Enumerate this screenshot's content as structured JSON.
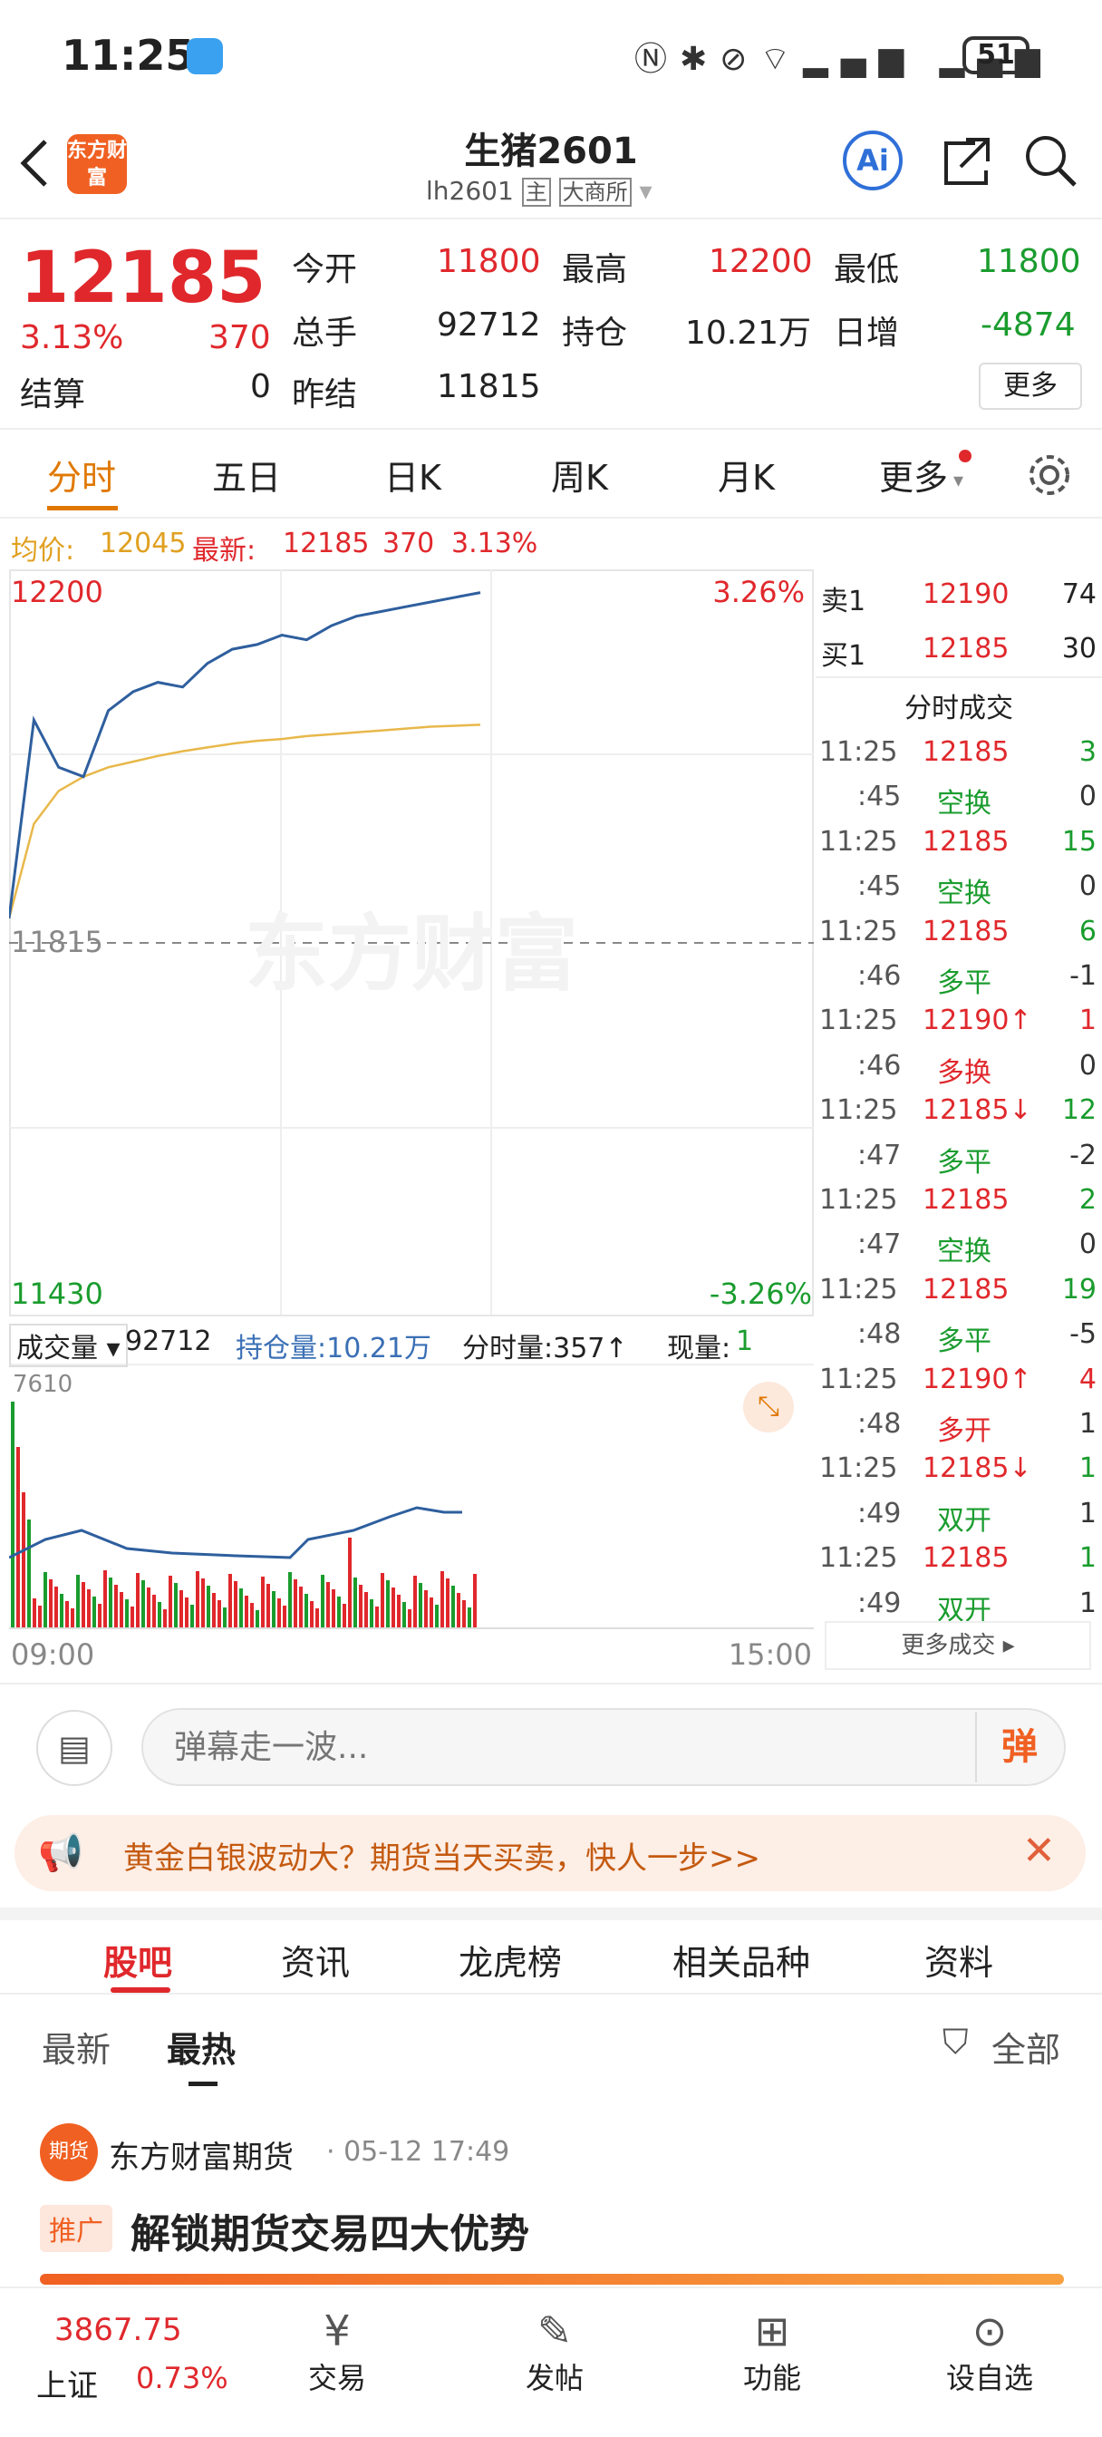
{
  "status": {
    "time": "11:25",
    "battery": "51"
  },
  "header": {
    "title": "生猪2601",
    "code": "lh2601",
    "tag_main": "主",
    "exchange": "大商所",
    "logo_text": "东方财富",
    "ai": "Ai"
  },
  "quote": {
    "price": "12185",
    "pct": "3.13%",
    "change": "370",
    "settle_label": "结算",
    "settle": "0",
    "open_label": "今开",
    "open": "11800",
    "high_label": "最高",
    "high": "12200",
    "low_label": "最低",
    "low": "11800",
    "vol_label": "总手",
    "vol": "92712",
    "oi_label": "持仓",
    "oi": "10.21万",
    "oi_chg_label": "日增",
    "oi_chg": "-4874",
    "prev_label": "昨结",
    "prev": "11815",
    "more": "更多"
  },
  "tabs": [
    "分时",
    "五日",
    "日K",
    "周K",
    "月K",
    "更多"
  ],
  "info": {
    "avg_label": "均价:",
    "avg": "12045",
    "last_label": "最新:",
    "last": "12185",
    "chg": "370",
    "pct": "3.13%"
  },
  "chart": {
    "y_top": "12200",
    "y_bottom": "11430",
    "pct_top": "3.26%",
    "pct_bottom": "-3.26%",
    "prev": "11815",
    "watermark": "东方财富",
    "vol_max": "7610",
    "time_start": "09:00",
    "time_end": "15:00",
    "vol_label": "成交量",
    "vol": "92712",
    "oi_label": "持仓量:10.21万",
    "tick_label": "分时量:357↑",
    "cur_label": "现量:",
    "cur": "1"
  },
  "chart_data": {
    "type": "line",
    "series": [
      {
        "name": "最新",
        "values": [
          11840,
          12050,
          12000,
          11990,
          12060,
          12080,
          12090,
          12085,
          12110,
          12125,
          12130,
          12140,
          12135,
          12150,
          12160,
          12165,
          12170,
          12175,
          12180,
          12185
        ]
      },
      {
        "name": "均价",
        "values": [
          11840,
          11940,
          11975,
          11990,
          12000,
          12006,
          12012,
          12017,
          12021,
          12025,
          12028,
          12030,
          12033,
          12035,
          12037,
          12039,
          12041,
          12043,
          12044,
          12045
        ]
      }
    ],
    "ylim": [
      11430,
      12200
    ]
  },
  "depth": {
    "sell_label": "卖1",
    "sell_price": "12190",
    "sell_vol": "74",
    "buy_label": "买1",
    "buy_price": "12185",
    "buy_vol": "30",
    "title": "分时成交",
    "more": "更多成交",
    "rows": [
      {
        "t": "11:25",
        "p": "12185",
        "v": "3",
        "pc": "red",
        "vc": "green"
      },
      {
        "t": ":45",
        "p": "空换",
        "v": "0",
        "pc": "green",
        "vc": "gray"
      },
      {
        "t": "11:25",
        "p": "12185",
        "v": "15",
        "pc": "red",
        "vc": "green"
      },
      {
        "t": ":45",
        "p": "空换",
        "v": "0",
        "pc": "green",
        "vc": "gray"
      },
      {
        "t": "11:25",
        "p": "12185",
        "v": "6",
        "pc": "red",
        "vc": "green"
      },
      {
        "t": ":46",
        "p": "多平",
        "v": "-1",
        "pc": "green",
        "vc": "gray"
      },
      {
        "t": "11:25",
        "p": "12190↑",
        "v": "1",
        "pc": "red",
        "vc": "red"
      },
      {
        "t": ":46",
        "p": "多换",
        "v": "0",
        "pc": "red",
        "vc": "gray"
      },
      {
        "t": "11:25",
        "p": "12185↓",
        "v": "12",
        "pc": "red",
        "vc": "green"
      },
      {
        "t": ":47",
        "p": "多平",
        "v": "-2",
        "pc": "green",
        "vc": "gray"
      },
      {
        "t": "11:25",
        "p": "12185",
        "v": "2",
        "pc": "red",
        "vc": "green"
      },
      {
        "t": ":47",
        "p": "空换",
        "v": "0",
        "pc": "green",
        "vc": "gray"
      },
      {
        "t": "11:25",
        "p": "12185",
        "v": "19",
        "pc": "red",
        "vc": "green"
      },
      {
        "t": ":48",
        "p": "多平",
        "v": "-5",
        "pc": "green",
        "vc": "gray"
      },
      {
        "t": "11:25",
        "p": "12190↑",
        "v": "4",
        "pc": "red",
        "vc": "red"
      },
      {
        "t": ":48",
        "p": "多开",
        "v": "1",
        "pc": "red",
        "vc": "gray"
      },
      {
        "t": "11:25",
        "p": "12185↓",
        "v": "1",
        "pc": "red",
        "vc": "green"
      },
      {
        "t": ":49",
        "p": "双开",
        "v": "1",
        "pc": "green",
        "vc": "gray"
      },
      {
        "t": "11:25",
        "p": "12185",
        "v": "1",
        "pc": "red",
        "vc": "green"
      },
      {
        "t": ":49",
        "p": "双开",
        "v": "1",
        "pc": "green",
        "vc": "gray"
      }
    ]
  },
  "danmu": {
    "placeholder": "弹幕走一波...",
    "btn": "弹"
  },
  "banner": {
    "text": "黄金白银波动大？期货当天买卖，快人一步>>"
  },
  "navtabs": [
    "股吧",
    "资讯",
    "龙虎榜",
    "相关品种",
    "资料"
  ],
  "sub": {
    "latest": "最新",
    "hot": "最热",
    "filter": "全部"
  },
  "post": {
    "author": "东方财富期货",
    "date": "· 05-12 17:49",
    "badge": "推广",
    "title": "解锁期货交易四大优势",
    "avatar": "期货"
  },
  "bottom": {
    "index": "3867.75",
    "index_name": "上证",
    "index_pct": "0.73%",
    "trade": "交易",
    "post": "发帖",
    "func": "功能",
    "watch": "设自选"
  }
}
